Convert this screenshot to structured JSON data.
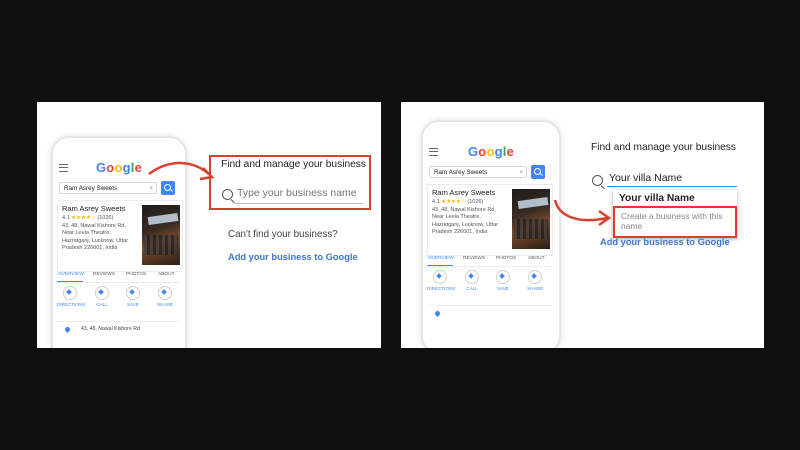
{
  "phone": {
    "google_logo": [
      "G",
      "o",
      "o",
      "g",
      "l",
      "e"
    ],
    "search_query": "Ram Asrey Sweets",
    "clear_icon": "×",
    "business": {
      "name": "Ram Asrey Sweets",
      "rating_text": "4.1",
      "stars": "★★★★☆",
      "review_count": "(1026)",
      "address_line1": "43, 48, Nawal Kishore Rd,",
      "address_line2": "Near Leela Theatre,",
      "address_line3": "Hazratganj, Lucknow, Uttar",
      "address_line4": "Pradesh 226001, India"
    },
    "tabs": [
      "OVERVIEW",
      "REVIEWS",
      "PHOTOS",
      "ABOUT"
    ],
    "actions": [
      "DIRECTIONS",
      "CALL",
      "SAVE",
      "SHARE"
    ],
    "location_text": "43, 48, Nawal Kishore Rd"
  },
  "left_panel": {
    "title": "Find and manage your business",
    "search_placeholder": "Type your business name",
    "cant_find": "Can't find your business?",
    "add_link": "Add your business to Google"
  },
  "right_panel": {
    "title": "Find and manage your business",
    "search_value": "Your villa Name",
    "dropdown_title": "Your villa Name",
    "dropdown_create": "Create a business with this name",
    "add_link": "Add your business to Google"
  },
  "colors": {
    "annotation_red": "#d9402f",
    "google_blue": "#4285f4",
    "link_blue": "#3c76c7"
  }
}
